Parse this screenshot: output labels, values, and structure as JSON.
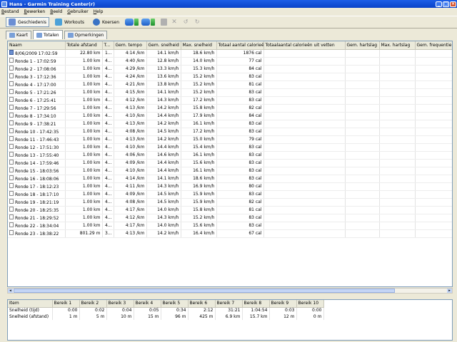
{
  "window": {
    "title": "Hans - Garmin Training Center(r)",
    "min": "_",
    "max": "□",
    "close": "×"
  },
  "menu": [
    "Bestand",
    "Bewerken",
    "Beeld",
    "Gebruiker",
    "Help"
  ],
  "toolbar": {
    "history": "Geschiedenis",
    "workouts": "Workouts",
    "courses": "Koersen"
  },
  "subtabs": {
    "map": "Kaart",
    "totals": "Totalen",
    "notes": "Opmerkingen"
  },
  "grid": {
    "columns": [
      "Naam",
      "Totale afstand",
      "T...",
      "Gem. tempo",
      "Gem. snelheid",
      "Max. snelheid",
      "Totaal aantal calorieën",
      "Totaalaantal calorieën uit vetten",
      "Gem. hartslag",
      "Max. hartslag",
      "Gem. frequentie"
    ],
    "rows": [
      [
        "8/06/2009 17:02:59",
        "22.80 km",
        "1...",
        "4:14 /km",
        "14.1 km/h",
        "18.6 km/h",
        "1876 cal"
      ],
      [
        "Ronde 1 - 17:02:59",
        "1.00 km",
        "4...",
        "4:40 /km",
        "12.8 km/h",
        "14.0 km/h",
        "77 cal"
      ],
      [
        "Ronde 2 - 17:08:06",
        "1.00 km",
        "4...",
        "4:29 /km",
        "13.3 km/h",
        "15.3 km/h",
        "84 cal"
      ],
      [
        "Ronde 3 - 17:12:36",
        "1.00 km",
        "4...",
        "4:24 /km",
        "13.6 km/h",
        "15.2 km/h",
        "83 cal"
      ],
      [
        "Ronde 4 - 17:17:00",
        "1.00 km",
        "4...",
        "4:21 /km",
        "13.8 km/h",
        "15.2 km/h",
        "81 cal"
      ],
      [
        "Ronde 5 - 17:21:26",
        "1.00 km",
        "4...",
        "4:15 /km",
        "14.1 km/h",
        "15.2 km/h",
        "83 cal"
      ],
      [
        "Ronde 6 - 17:25:41",
        "1.00 km",
        "4...",
        "4:12 /km",
        "14.3 km/h",
        "17.2 km/h",
        "83 cal"
      ],
      [
        "Ronde 7 - 17:29:56",
        "1.00 km",
        "4...",
        "4:13 /km",
        "14.2 km/h",
        "15.8 km/h",
        "82 cal"
      ],
      [
        "Ronde 8 - 17:34:10",
        "1.00 km",
        "4...",
        "4:10 /km",
        "14.4 km/h",
        "17.9 km/h",
        "84 cal"
      ],
      [
        "Ronde 9 - 17:38:21",
        "1.00 km",
        "4...",
        "4:13 /km",
        "14.2 km/h",
        "16.1 km/h",
        "83 cal"
      ],
      [
        "Ronde 10 - 17:42:35",
        "1.00 km",
        "4...",
        "4:08 /km",
        "14.5 km/h",
        "17.2 km/h",
        "83 cal"
      ],
      [
        "Ronde 11 - 17:46:43",
        "1.00 km",
        "4...",
        "4:13 /km",
        "14.2 km/h",
        "15.0 km/h",
        "79 cal"
      ],
      [
        "Ronde 12 - 17:51:30",
        "1.00 km",
        "4...",
        "4:10 /km",
        "14.4 km/h",
        "15.4 km/h",
        "83 cal"
      ],
      [
        "Ronde 13 - 17:55:40",
        "1.00 km",
        "4...",
        "4:06 /km",
        "14.6 km/h",
        "16.1 km/h",
        "83 cal"
      ],
      [
        "Ronde 14 - 17:59:46",
        "1.00 km",
        "4...",
        "4:09 /km",
        "14.4 km/h",
        "15.6 km/h",
        "83 cal"
      ],
      [
        "Ronde 15 - 18:03:56",
        "1.00 km",
        "4...",
        "4:10 /km",
        "14.4 km/h",
        "16.1 km/h",
        "83 cal"
      ],
      [
        "Ronde 16 - 18:08:06",
        "1.00 km",
        "4...",
        "4:14 /km",
        "14.1 km/h",
        "18.6 km/h",
        "83 cal"
      ],
      [
        "Ronde 17 - 18:12:23",
        "1.00 km",
        "4...",
        "4:11 /km",
        "14.3 km/h",
        "16.9 km/h",
        "80 cal"
      ],
      [
        "Ronde 18 - 18:17:10",
        "1.00 km",
        "4...",
        "4:09 /km",
        "14.5 km/h",
        "15.9 km/h",
        "83 cal"
      ],
      [
        "Ronde 19 - 18:21:19",
        "1.00 km",
        "4...",
        "4:08 /km",
        "14.5 km/h",
        "15.9 km/h",
        "82 cal"
      ],
      [
        "Ronde 20 - 18:25:35",
        "1.00 km",
        "4...",
        "4:17 /km",
        "14.0 km/h",
        "15.8 km/h",
        "81 cal"
      ],
      [
        "Ronde 21 - 18:29:52",
        "1.00 km",
        "4...",
        "4:12 /km",
        "14.3 km/h",
        "15.2 km/h",
        "83 cal"
      ],
      [
        "Ronde 22 - 18:34:04",
        "1.00 km",
        "4...",
        "4:17 /km",
        "14.0 km/h",
        "15.6 km/h",
        "83 cal"
      ],
      [
        "Ronde 23 - 18:38:22",
        "801.29 m",
        "3...",
        "4:13 /km",
        "14.2 km/h",
        "16.4 km/h",
        "67 cal"
      ]
    ]
  },
  "zones": {
    "columns": [
      "Item",
      "Bereik 1",
      "Bereik 2",
      "Bereik 3",
      "Bereik 4",
      "Bereik 5",
      "Bereik 6",
      "Bereik 7",
      "Bereik 8",
      "Bereik 9",
      "Bereik 10"
    ],
    "rows": [
      [
        "Snelheid (tijd)",
        "0:00",
        "0:02",
        "0:04",
        "0:05",
        "0:34",
        "2:12",
        "31:21",
        "1:04:54",
        "0:03",
        "0:00"
      ],
      [
        "Snelheid (afstand)",
        "1 m",
        "5 m",
        "10 m",
        "15 m",
        "96 m",
        "425 m",
        "6.9 km",
        "15.7 km",
        "12 m",
        "0 m"
      ]
    ]
  }
}
